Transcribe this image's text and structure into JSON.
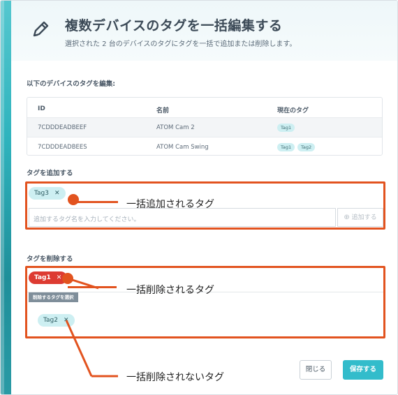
{
  "header": {
    "title": "複数デバイスのタグを一括編集する",
    "subtitle": "選択された 2 台のデバイスのタグにタグを一括で追加または削除します。"
  },
  "devices_section": {
    "label": "以下のデバイスのタグを編集:",
    "columns": [
      "ID",
      "名前",
      "現在のタグ"
    ],
    "rows": [
      {
        "id": "7CDDDEADBEEF",
        "name": "ATOM Cam 2",
        "tags": [
          "Tag1"
        ]
      },
      {
        "id": "7CDDDEADBEES",
        "name": "ATOM Cam Swing",
        "tags": [
          "Tag1",
          "Tag2"
        ]
      }
    ]
  },
  "add_section": {
    "label": "タグを追加する",
    "tags": [
      "Tag3"
    ],
    "input_placeholder": "追加するタグ名を入力してください。",
    "add_button": "追加する"
  },
  "remove_section": {
    "label": "タグを削除する",
    "selected_tags": [
      "Tag1"
    ],
    "select_header": "削除するタグを選択",
    "available_tags": [
      "Tag2"
    ]
  },
  "annotations": {
    "add": "一括追加されるタグ",
    "remove": "一括削除されるタグ",
    "keep": "一括削除されないタグ"
  },
  "footer": {
    "close_button": "閉じる",
    "save_button": "保存する"
  },
  "colors": {
    "accent": "#33bccb",
    "annotation": "#e2531f",
    "remove_tag": "#dd3b32",
    "tag": "#cdeff2"
  },
  "icons": {
    "title_icon": "pencil-icon",
    "add_icon": "plus-circle-icon",
    "remove_icon": "close-icon"
  }
}
